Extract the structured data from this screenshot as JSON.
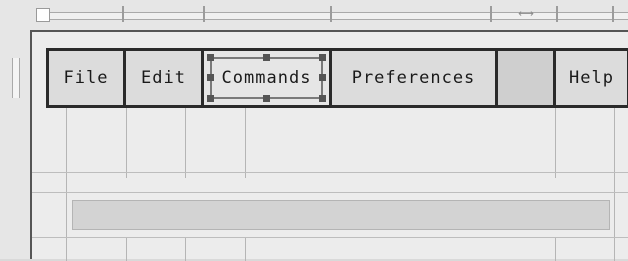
{
  "menubar": {
    "items": [
      {
        "label": "File"
      },
      {
        "label": "Edit"
      },
      {
        "label": "Commands",
        "selected": true
      },
      {
        "label": "Preferences"
      },
      {
        "label": ""
      },
      {
        "label": "Help"
      }
    ]
  },
  "rulers": {
    "top_scroll_arrow": "⟷"
  },
  "colors": {
    "menu_border": "#2a2a2a",
    "menu_background": "#dcdcdc",
    "canvas_background": "#ececec",
    "selection_handles": "#555555"
  }
}
